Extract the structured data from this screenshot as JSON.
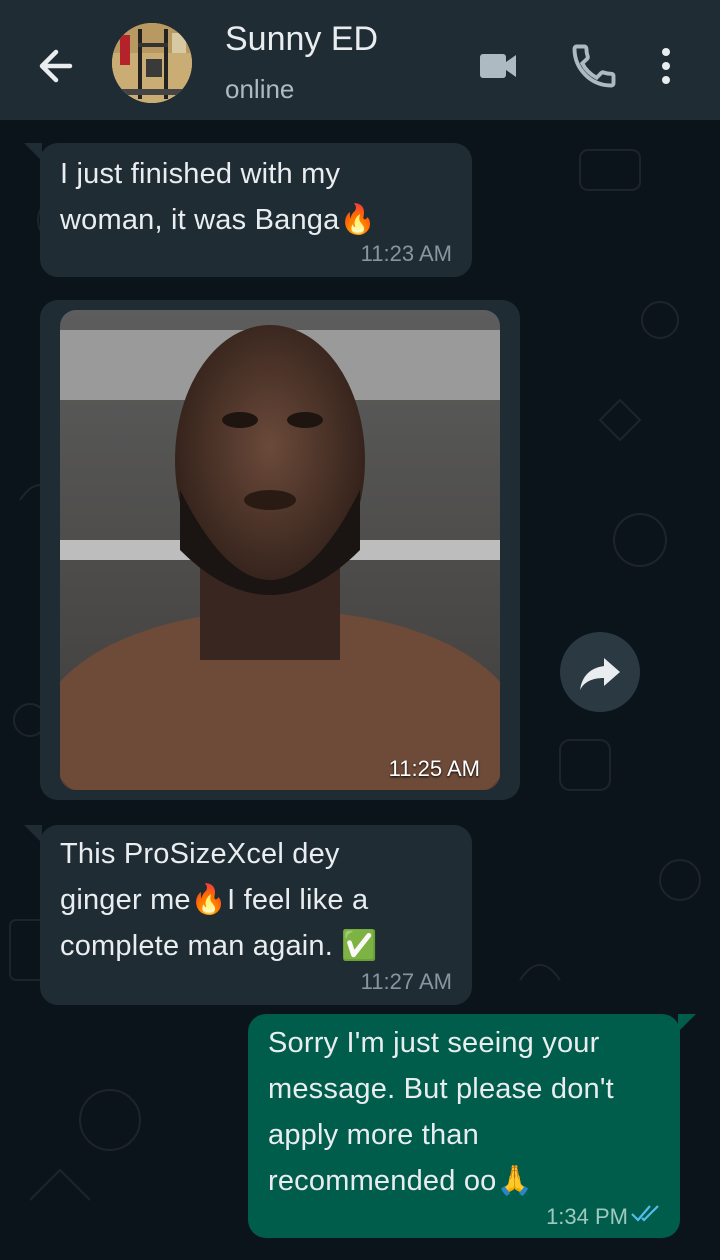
{
  "header": {
    "contact_name": "Sunny ED",
    "status": "online"
  },
  "messages": [
    {
      "direction": "incoming",
      "lines": [
        "I just finished with my",
        "woman, it was Banga🔥"
      ],
      "time": "11:23 AM"
    },
    {
      "direction": "incoming",
      "type": "image",
      "time": "11:25 AM"
    },
    {
      "direction": "incoming",
      "lines": [
        "This ProSizeXcel dey",
        "ginger me🔥I feel like a",
        "complete man again. ✅"
      ],
      "time": "11:27 AM"
    },
    {
      "direction": "outgoing",
      "lines": [
        "Sorry I'm just seeing your",
        "message. But please don't",
        "apply more than",
        "recommended oo🙏"
      ],
      "time": "1:34 PM",
      "read_receipt": "double-check"
    }
  ],
  "colors": {
    "header_bg": "#1f2c34",
    "chat_bg": "#0b141a",
    "incoming_bubble": "#1f2c34",
    "outgoing_bubble": "#005c4b",
    "read_tick": "#53bdeb"
  },
  "icons": [
    "back-arrow-icon",
    "video-call-icon",
    "phone-icon",
    "more-options-icon",
    "forward-icon",
    "double-check-icon"
  ]
}
